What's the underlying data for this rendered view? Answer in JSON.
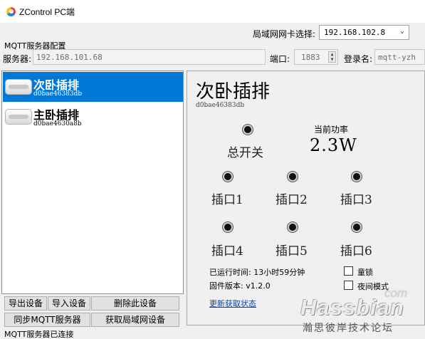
{
  "window": {
    "title": "ZControl PC端"
  },
  "nic": {
    "label": "局域网网卡选择:",
    "selected": "192.168.102.8"
  },
  "mqtt": {
    "group_title": "MQTT服务器配置",
    "server_label": "服务器:",
    "server_value": "192.168.101.68",
    "port_label": "端口:",
    "port_value": "1883",
    "login_label": "登录名:",
    "login_value": "mqtt-yzh"
  },
  "devices": [
    {
      "name": "次卧插排",
      "id": "d0bae46383db",
      "selected": true
    },
    {
      "name": "主卧插排",
      "id": "d0bae4630a8b",
      "selected": false
    }
  ],
  "detail": {
    "name": "次卧插排",
    "id": "d0bae46383db",
    "master_label": "总开关",
    "power_title": "当前功率",
    "power_value": "2.3W",
    "sockets": [
      "插口1",
      "插口2",
      "插口3",
      "插口4",
      "插口5",
      "插口6"
    ],
    "runtime_label": "已运行时间:",
    "runtime_value": "13小时59分钟",
    "firmware_label": "固件版本:",
    "firmware_value": "v1.2.0",
    "child_lock_label": "童锁",
    "night_mode_label": "夜间模式",
    "refresh_link": "更新获取状态"
  },
  "buttons": {
    "export": "导出设备",
    "import": "导入设备",
    "delete": "删除此设备",
    "sync": "同步MQTT服务器",
    "fetch": "获取局域网设备"
  },
  "status": "MQTT服务器已连接",
  "watermark": {
    "com": "com",
    "main": "Hassbian",
    "cn": "瀚思彼岸技术论坛"
  },
  "icons": {
    "app": "zcontrol-logo-icon",
    "dropdown": "chevron-down-icon",
    "spinner": "spin-arrows-icon",
    "device": "power-strip-icon",
    "switch": "switch-dot-icon"
  },
  "colors": {
    "selection": "#0078d7",
    "link": "#0645ad",
    "window_bg": "#f0f0f0"
  }
}
